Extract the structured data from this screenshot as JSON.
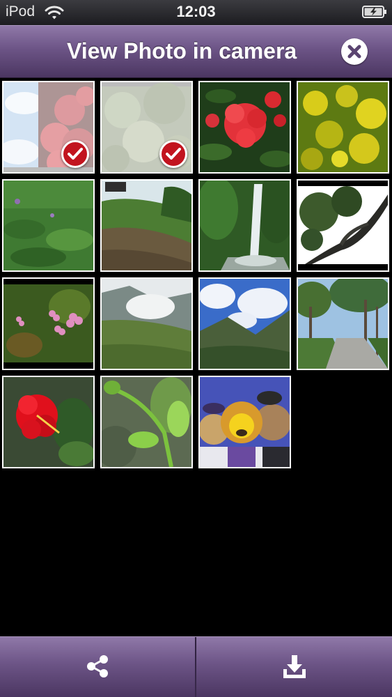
{
  "status_bar": {
    "carrier": "iPod",
    "time": "12:03",
    "wifi_icon": "wifi-icon",
    "battery_icon": "battery-charging-icon"
  },
  "header": {
    "title": "View Photo in camera",
    "close_icon": "close-icon"
  },
  "colors": {
    "bar_top": "#8f78a8",
    "bar_bottom": "#4b3661",
    "check_badge": "#c2141f"
  },
  "photos": [
    {
      "subject": "red-flowers-sky",
      "selected": true
    },
    {
      "subject": "pale-foliage",
      "selected": true
    },
    {
      "subject": "red-rhododendron",
      "selected": false
    },
    {
      "subject": "yellow-blossoms",
      "selected": false
    },
    {
      "subject": "green-meadow",
      "selected": false
    },
    {
      "subject": "hillside-slope",
      "selected": false
    },
    {
      "subject": "waterfall",
      "selected": false
    },
    {
      "subject": "tree-branches",
      "selected": false
    },
    {
      "subject": "pink-wildflowers",
      "selected": false
    },
    {
      "subject": "misty-mountain",
      "selected": false
    },
    {
      "subject": "mountain-valley-sky",
      "selected": false
    },
    {
      "subject": "palm-tree-road",
      "selected": false
    },
    {
      "subject": "red-hibiscus",
      "selected": false
    },
    {
      "subject": "green-plant-sprout",
      "selected": false
    },
    {
      "subject": "plush-lion-toys",
      "selected": false
    }
  ],
  "toolbar": {
    "share_icon": "share-icon",
    "download_icon": "download-icon"
  }
}
